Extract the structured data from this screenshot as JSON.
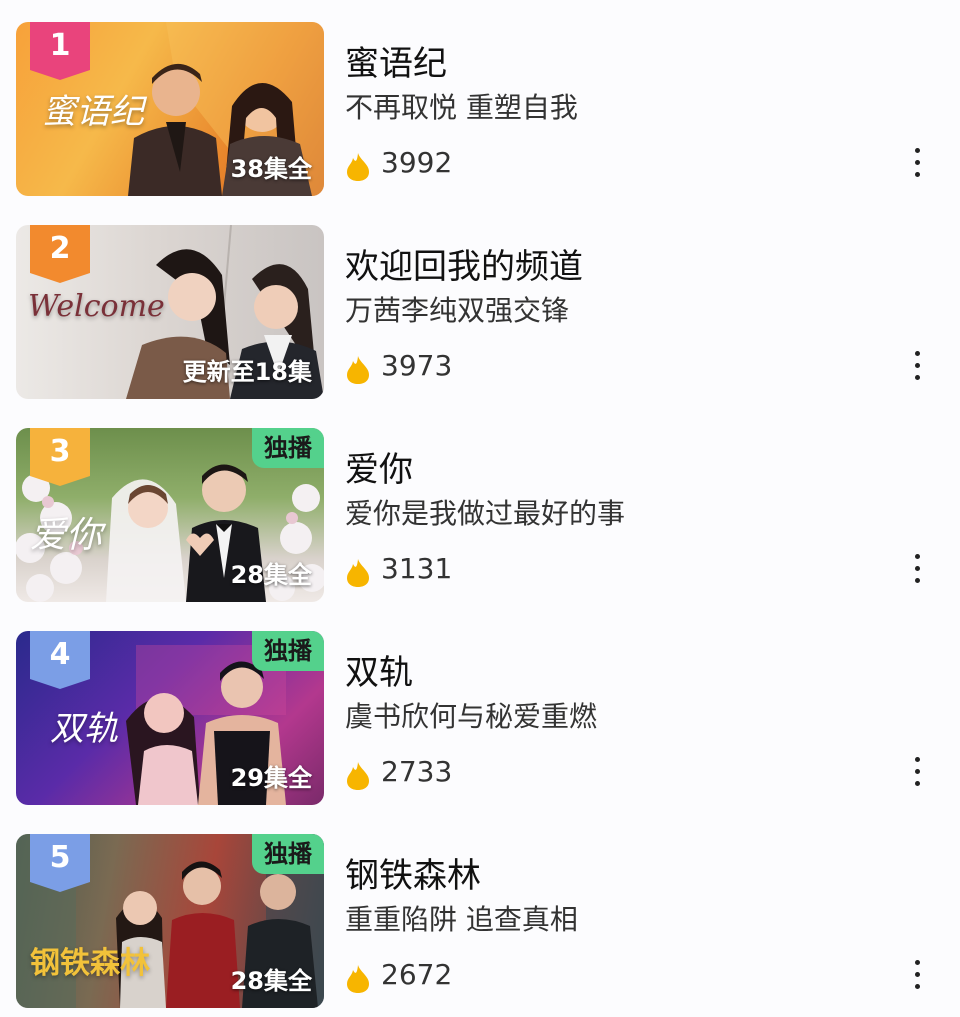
{
  "colors": {
    "rank_top": "#e9447c",
    "rank_2": "#f28a2e",
    "rank_3": "#f6b23c",
    "rank_other": "#7b9ee6",
    "exclusive_badge": "#54d18c",
    "flame": "#f7b500"
  },
  "icons": {
    "heat": "flame-icon",
    "more": "more-vertical-icon"
  },
  "items": [
    {
      "rank": "1",
      "title": "蜜语纪",
      "subtitle": "不再取悦 重塑自我",
      "heat": "3992",
      "episodes": "38集全",
      "badge": ""
    },
    {
      "rank": "2",
      "title": "欢迎回我的频道",
      "subtitle": "万茜李纯双强交锋",
      "heat": "3973",
      "episodes": "更新至18集",
      "badge": ""
    },
    {
      "rank": "3",
      "title": "爱你",
      "subtitle": "爱你是我做过最好的事",
      "heat": "3131",
      "episodes": "28集全",
      "badge": "独播"
    },
    {
      "rank": "4",
      "title": "双轨",
      "subtitle": "虞书欣何与秘爱重燃",
      "heat": "2733",
      "episodes": "29集全",
      "badge": "独播"
    },
    {
      "rank": "5",
      "title": "钢铁森林",
      "subtitle": "重重陷阱 追查真相",
      "heat": "2672",
      "episodes": "28集全",
      "badge": "独播"
    }
  ]
}
